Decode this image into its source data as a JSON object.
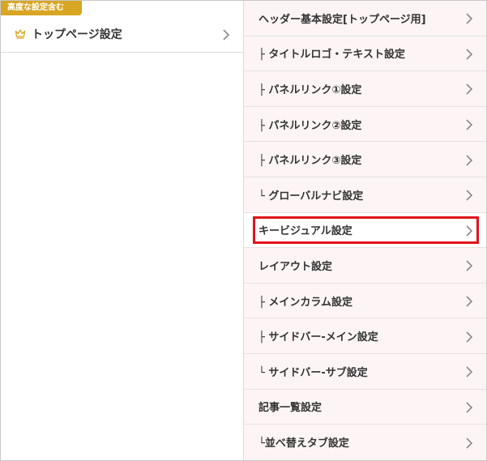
{
  "left": {
    "badge": "高度な設定含む",
    "item": {
      "label": "トップページ設定",
      "icon": "crown-icon"
    }
  },
  "menu": {
    "items": [
      {
        "label": "ヘッダー基本設定[トップページ用]"
      },
      {
        "label": "├ タイトルロゴ・テキスト設定"
      },
      {
        "label": "├ パネルリンク①設定"
      },
      {
        "label": "├ パネルリンク②設定"
      },
      {
        "label": "├ パネルリンク③設定"
      },
      {
        "label": "└ グローバルナビ設定"
      },
      {
        "label": "キービジュアル設定"
      },
      {
        "label": "レイアウト設定"
      },
      {
        "label": "├ メインカラム設定"
      },
      {
        "label": "├ サイドバー-メイン設定"
      },
      {
        "label": "└ サイドバー-サブ設定"
      },
      {
        "label": "記事一覧設定"
      },
      {
        "label": "└並べ替えタブ設定"
      }
    ],
    "selected_index": 6
  },
  "colors": {
    "badge": "#d8a623",
    "row_bg": "#fdf5f5",
    "highlight": "#e0141a",
    "chevron": "#8a8a8a"
  }
}
